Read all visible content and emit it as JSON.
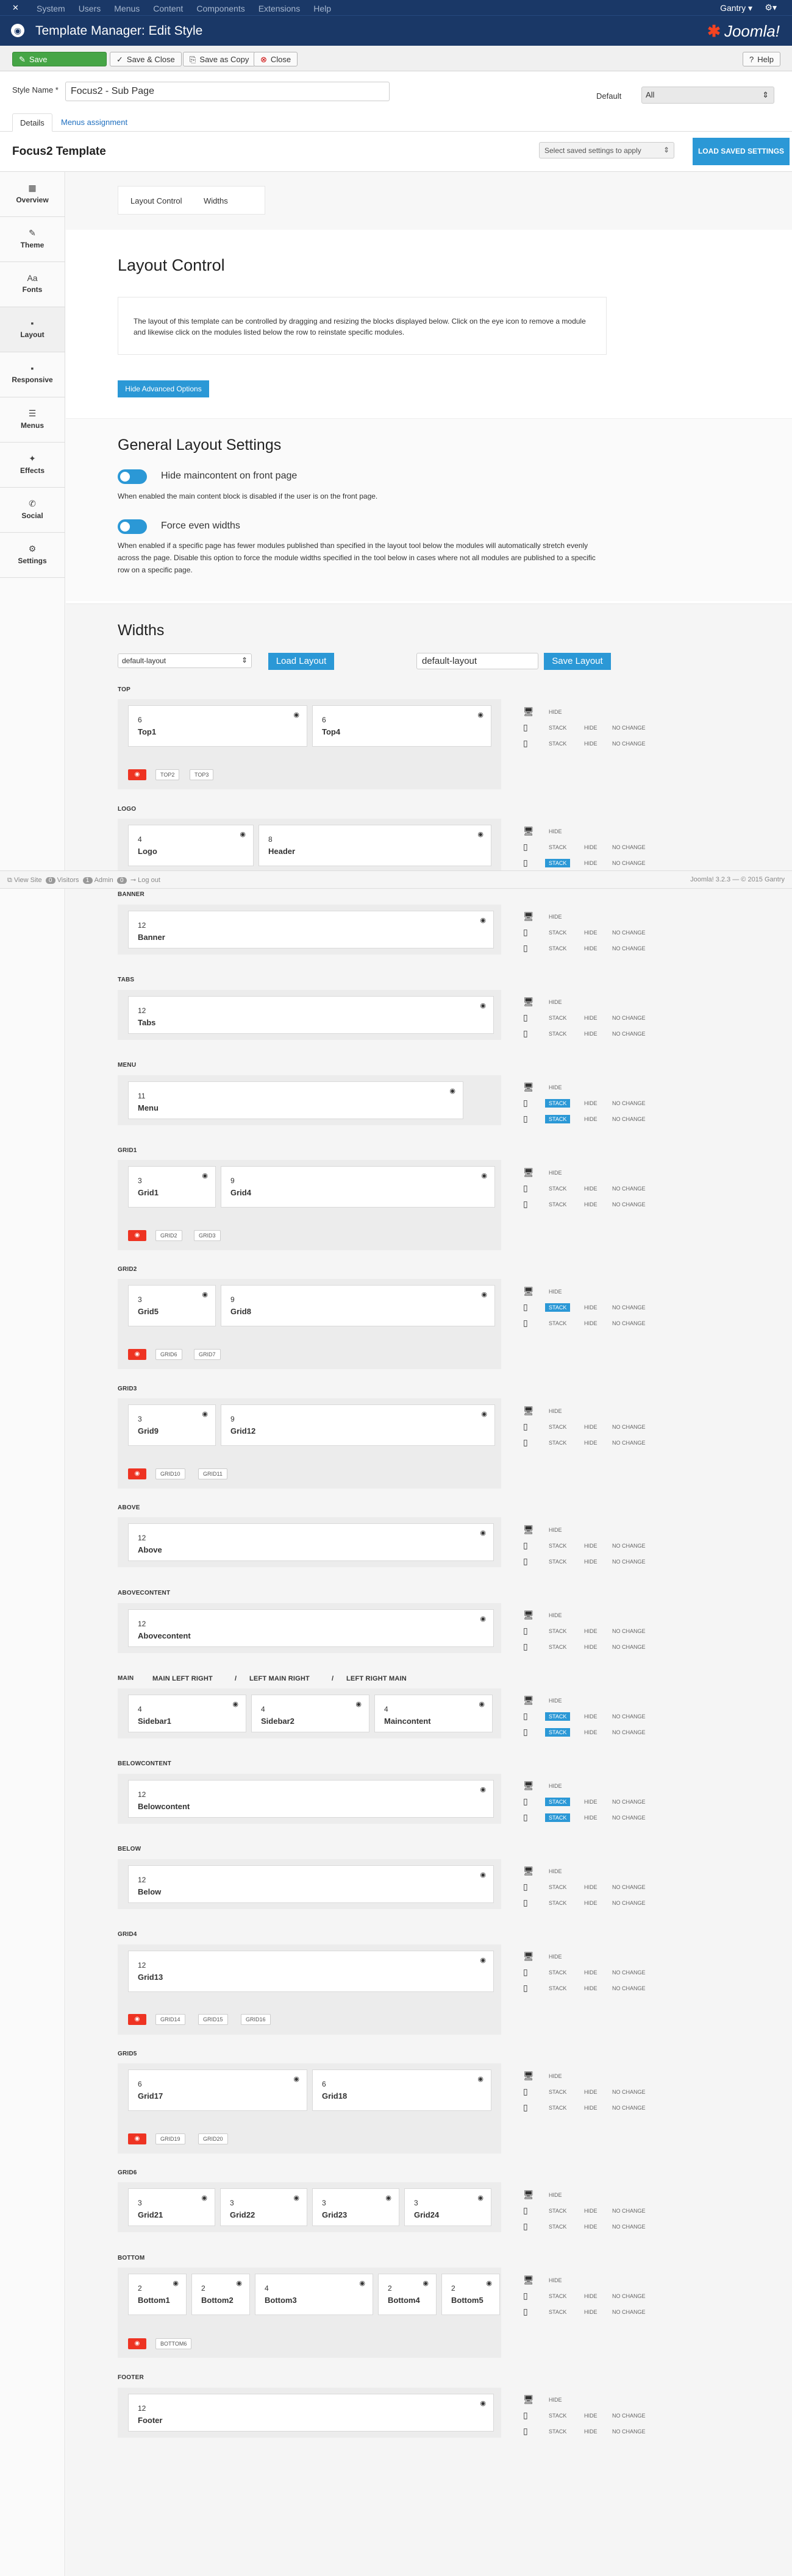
{
  "topnav": {
    "items": [
      "System",
      "Users",
      "Menus",
      "Content",
      "Components",
      "Extensions",
      "Help"
    ],
    "user": "Gantry",
    "user_caret": "▾"
  },
  "header": {
    "title": "Template Manager: Edit Style",
    "brand": "Joomla!"
  },
  "toolbar": {
    "save": "Save",
    "save_close": "Save & Close",
    "save_copy": "Save as Copy",
    "close": "Close",
    "help": "Help"
  },
  "form": {
    "style_name_label": "Style Name *",
    "style_name_value": "Focus2 - Sub Page",
    "default_label": "Default",
    "default_value": "All"
  },
  "tabs": {
    "details": "Details",
    "menus": "Menus assignment"
  },
  "template": {
    "title": "Focus2 Template",
    "select_saved": "Select saved settings to apply",
    "load_saved": "LOAD SAVED SETTINGS"
  },
  "sidebar": [
    {
      "label": "Overview",
      "icon": "▦"
    },
    {
      "label": "Theme",
      "icon": "✎"
    },
    {
      "label": "Fonts",
      "icon": "Aa"
    },
    {
      "label": "Layout",
      "icon": "▪"
    },
    {
      "label": "Responsive",
      "icon": "▪"
    },
    {
      "label": "Menus",
      "icon": "☰"
    },
    {
      "label": "Effects",
      "icon": "✦"
    },
    {
      "label": "Social",
      "icon": "✆"
    },
    {
      "label": "Settings",
      "icon": "⚙"
    }
  ],
  "subtabs": {
    "layout_control": "Layout Control",
    "widths": "Widths"
  },
  "layout_control": {
    "title": "Layout Control",
    "info": "The layout of this template can be controlled by dragging and resizing the blocks displayed below. Click on the eye icon to remove a module and likewise click on the modules listed below the row to reinstate specific modules.",
    "hide_advanced": "Hide Advanced Options"
  },
  "general": {
    "title": "General Layout Settings",
    "hide_main": "Hide maincontent on front page",
    "hide_main_help": "When enabled the main content block is disabled if the user is on the front page.",
    "force_even": "Force even widths",
    "force_even_help": "When enabled if a specific page has fewer modules published than specified in the layout tool below the modules will automatically stretch evenly across the page. Disable this option to force the module widths specified in the tool below in cases where not all modules are published to a specific row on a specific page."
  },
  "widths": {
    "title": "Widths",
    "select_value": "default-layout",
    "load": "Load Layout",
    "input_value": "default-layout",
    "save": "Save Layout"
  },
  "controls": {
    "hide": "HIDE",
    "stack": "STACK",
    "nochange": "NO CHANGE"
  },
  "statusbar": {
    "view_site": "View Site",
    "visitors_count": "0",
    "visitors": "Visitors",
    "admin_count": "1",
    "admin": "Admin",
    "msgs_count": "0",
    "logout": "Log out",
    "version": "Joomla! 3.2.3 — © 2015 Gantry"
  },
  "positions": {
    "top": {
      "label": "TOP",
      "mods": [
        {
          "n": "6",
          "name": "Top1"
        },
        {
          "n": "6",
          "name": "Top4"
        }
      ],
      "pills": [
        "TOP2",
        "TOP3"
      ]
    },
    "logo": {
      "label": "LOGO",
      "mods": [
        {
          "n": "4",
          "name": "Logo"
        },
        {
          "n": "8",
          "name": "Header"
        }
      ]
    },
    "banner": {
      "label": "BANNER",
      "mods": [
        {
          "n": "12",
          "name": "Banner"
        }
      ]
    },
    "tabs": {
      "label": "TABS",
      "mods": [
        {
          "n": "12",
          "name": "Tabs"
        }
      ]
    },
    "menu": {
      "label": "MENU",
      "mods": [
        {
          "n": "11",
          "name": "Menu"
        }
      ]
    },
    "grid1": {
      "label": "GRID1",
      "mods": [
        {
          "n": "3",
          "name": "Grid1"
        },
        {
          "n": "9",
          "name": "Grid4"
        }
      ],
      "pills": [
        "GRID2",
        "GRID3"
      ]
    },
    "grid2": {
      "label": "GRID2",
      "mods": [
        {
          "n": "3",
          "name": "Grid5"
        },
        {
          "n": "9",
          "name": "Grid8"
        }
      ],
      "pills": [
        "GRID6",
        "GRID7"
      ]
    },
    "grid3": {
      "label": "GRID3",
      "mods": [
        {
          "n": "3",
          "name": "Grid9"
        },
        {
          "n": "9",
          "name": "Grid12"
        }
      ],
      "pills": [
        "GRID10",
        "GRID11"
      ]
    },
    "above": {
      "label": "ABOVE",
      "mods": [
        {
          "n": "12",
          "name": "Above"
        }
      ]
    },
    "abovecontent": {
      "label": "ABOVECONTENT",
      "mods": [
        {
          "n": "12",
          "name": "Abovecontent"
        }
      ]
    },
    "main": {
      "label": "MAIN",
      "variants": [
        "MAIN LEFT RIGHT",
        "/",
        "LEFT MAIN RIGHT",
        "/",
        "LEFT RIGHT MAIN"
      ],
      "mods": [
        {
          "n": "4",
          "name": "Sidebar1"
        },
        {
          "n": "4",
          "name": "Sidebar2"
        },
        {
          "n": "4",
          "name": "Maincontent"
        }
      ]
    },
    "belowcontent": {
      "label": "BELOWCONTENT",
      "mods": [
        {
          "n": "12",
          "name": "Belowcontent"
        }
      ]
    },
    "below": {
      "label": "BELOW",
      "mods": [
        {
          "n": "12",
          "name": "Below"
        }
      ]
    },
    "grid4": {
      "label": "GRID4",
      "mods": [
        {
          "n": "12",
          "name": "Grid13"
        }
      ],
      "pills": [
        "GRID14",
        "GRID15",
        "GRID16"
      ]
    },
    "grid5": {
      "label": "GRID5",
      "mods": [
        {
          "n": "6",
          "name": "Grid17"
        },
        {
          "n": "6",
          "name": "Grid18"
        }
      ],
      "pills": [
        "GRID19",
        "GRID20"
      ]
    },
    "grid6": {
      "label": "GRID6",
      "mods": [
        {
          "n": "3",
          "name": "Grid21"
        },
        {
          "n": "3",
          "name": "Grid22"
        },
        {
          "n": "3",
          "name": "Grid23"
        },
        {
          "n": "3",
          "name": "Grid24"
        }
      ]
    },
    "bottom": {
      "label": "BOTTOM",
      "mods": [
        {
          "n": "2",
          "name": "Bottom1"
        },
        {
          "n": "2",
          "name": "Bottom2"
        },
        {
          "n": "4",
          "name": "Bottom3"
        },
        {
          "n": "2",
          "name": "Bottom4"
        },
        {
          "n": "2",
          "name": "Bottom5"
        }
      ],
      "pills": [
        "BOTTOM6"
      ]
    },
    "footer": {
      "label": "FOOTER",
      "mods": [
        {
          "n": "12",
          "name": "Footer"
        }
      ]
    }
  }
}
